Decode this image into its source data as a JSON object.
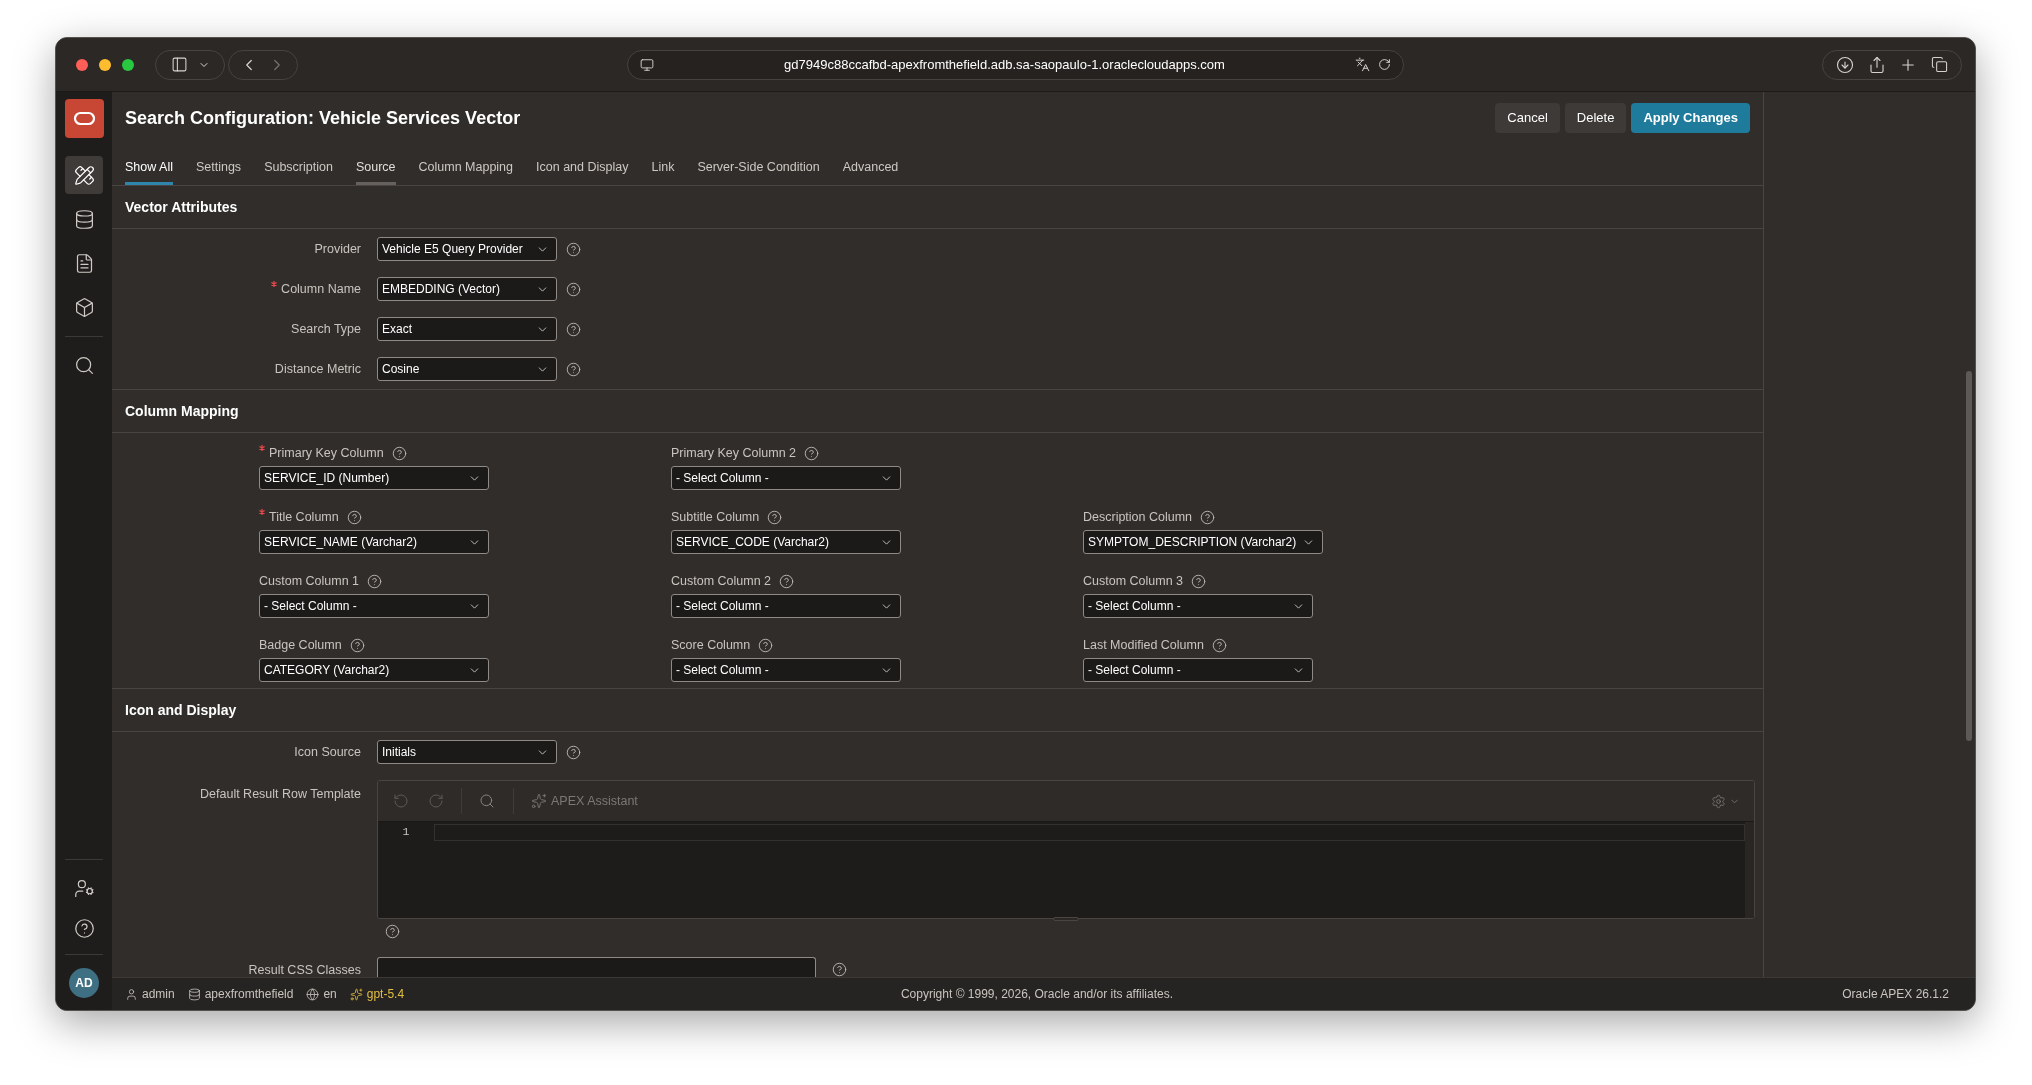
{
  "browser": {
    "url": "gd7949c88ccafbd-apexfromthefield.adb.sa-saopaulo-1.oraclecloudapps.com"
  },
  "nav": {
    "items": [
      {
        "kind": "tools",
        "selected": true
      },
      {
        "kind": "database",
        "selected": false
      },
      {
        "kind": "document",
        "selected": false
      },
      {
        "kind": "package",
        "selected": false
      },
      {
        "kind": "search",
        "selected": false
      }
    ],
    "bottom_items": [
      {
        "kind": "account"
      },
      {
        "kind": "help"
      }
    ],
    "avatar": "AD"
  },
  "header": {
    "title": "Search Configuration: Vehicle Services Vector",
    "buttons": [
      {
        "label": "Cancel",
        "kind": "secondary"
      },
      {
        "label": "Delete",
        "kind": "secondary"
      },
      {
        "label": "Apply Changes",
        "kind": "primary"
      }
    ]
  },
  "tabs": [
    {
      "label": "Show All",
      "selected": true,
      "hovered": false
    },
    {
      "label": "Settings",
      "selected": false,
      "hovered": false
    },
    {
      "label": "Subscription",
      "selected": false,
      "hovered": false
    },
    {
      "label": "Source",
      "selected": false,
      "hovered": true
    },
    {
      "label": "Column Mapping",
      "selected": false,
      "hovered": false
    },
    {
      "label": "Icon and Display",
      "selected": false,
      "hovered": false
    },
    {
      "label": "Link",
      "selected": false,
      "hovered": false
    },
    {
      "label": "Server-Side Condition",
      "selected": false,
      "hovered": false
    },
    {
      "label": "Advanced",
      "selected": false,
      "hovered": false
    }
  ],
  "sections": [
    {
      "title": "Vector Attributes",
      "kind": "form",
      "fields": [
        {
          "label": "Provider",
          "kind": "select",
          "required": false,
          "value": "Vehicle E5 Query Provider"
        },
        {
          "label": "Column Name",
          "kind": "select",
          "required": true,
          "value": "EMBEDDING (Vector)"
        },
        {
          "label": "Search Type",
          "kind": "select",
          "required": false,
          "value": "Exact"
        },
        {
          "label": "Distance Metric",
          "kind": "select",
          "required": false,
          "value": "Cosine"
        }
      ]
    },
    {
      "title": "Column Mapping",
      "kind": "grid",
      "rows": [
        [
          {
            "label": "Primary Key Column",
            "required": true,
            "value": "SERVICE_ID (Number)"
          },
          {
            "label": "Primary Key Column 2",
            "required": false,
            "value": "- Select Column -"
          }
        ],
        [
          {
            "label": "Title Column",
            "required": true,
            "value": "SERVICE_NAME (Varchar2)"
          },
          {
            "label": "Subtitle Column",
            "required": false,
            "value": "SERVICE_CODE (Varchar2)"
          },
          {
            "label": "Description Column",
            "required": false,
            "value": "SYMPTOM_DESCRIPTION (Varchar2)"
          }
        ],
        [
          {
            "label": "Custom Column 1",
            "required": false,
            "value": "- Select Column -"
          },
          {
            "label": "Custom Column 2",
            "required": false,
            "value": "- Select Column -"
          },
          {
            "label": "Custom Column 3",
            "required": false,
            "value": "- Select Column -"
          }
        ],
        [
          {
            "label": "Badge Column",
            "required": false,
            "value": "CATEGORY (Varchar2)"
          },
          {
            "label": "Score Column",
            "required": false,
            "value": "- Select Column -"
          },
          {
            "label": "Last Modified Column",
            "required": false,
            "value": "- Select Column -"
          }
        ]
      ]
    },
    {
      "title": "Icon and Display",
      "kind": "form",
      "fields": [
        {
          "label": "Icon Source",
          "kind": "select",
          "required": false,
          "value": "Initials"
        },
        {
          "label": "Default Result Row Template",
          "kind": "code_editor",
          "required": false,
          "assistant": "APEX Assistant",
          "line_numbers": [
            "1"
          ]
        },
        {
          "label": "Result CSS Classes",
          "kind": "text",
          "required": false
        }
      ]
    }
  ],
  "footer": {
    "user": "admin",
    "workspace": "apexfromthefield",
    "language": "en",
    "model": "gpt-5.4",
    "copyright": "Copyright © 1999, 2026, Oracle and/or its affiliates.",
    "version": "Oracle APEX 26.1.2"
  }
}
